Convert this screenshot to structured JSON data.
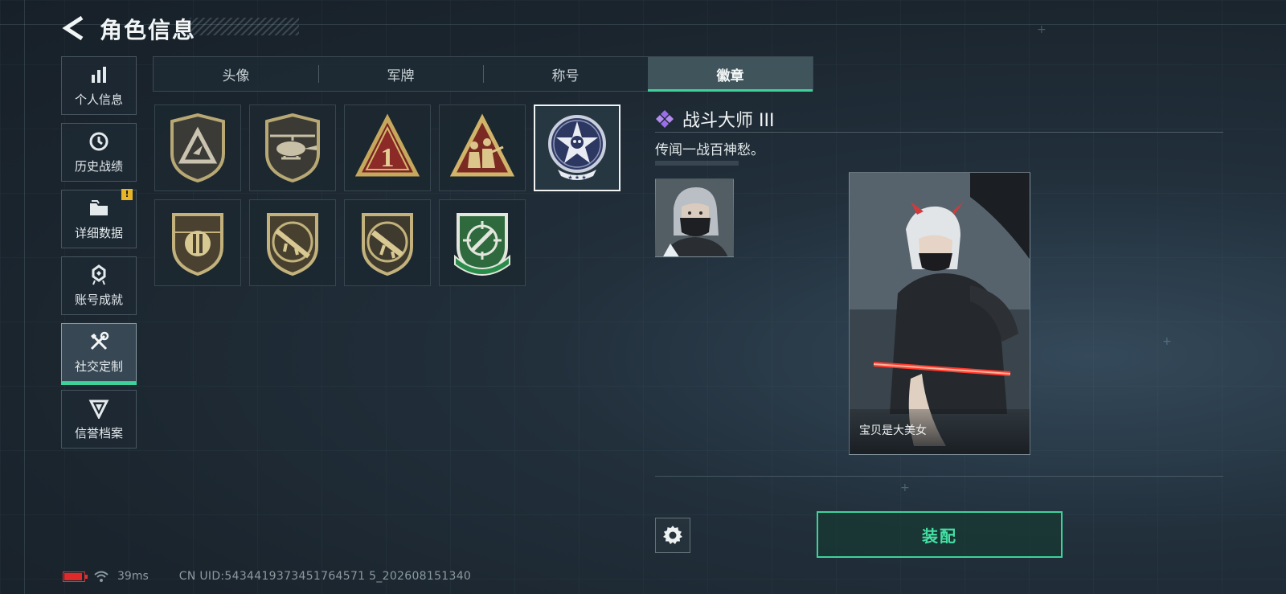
{
  "header": {
    "title": "角色信息"
  },
  "sidebar": {
    "items": [
      {
        "label": "个人信息",
        "icon": "bar-chart-icon"
      },
      {
        "label": "历史战绩",
        "icon": "clock-icon"
      },
      {
        "label": "详细数据",
        "icon": "folder-icon",
        "alert": "!"
      },
      {
        "label": "账号成就",
        "icon": "medal-icon"
      },
      {
        "label": "社交定制",
        "icon": "tools-icon",
        "active": true
      },
      {
        "label": "信誉档案",
        "icon": "shield-rank-icon"
      }
    ]
  },
  "tabs": [
    {
      "label": "头像"
    },
    {
      "label": "军牌"
    },
    {
      "label": "称号"
    },
    {
      "label": "徽章",
      "active": true
    }
  ],
  "badges": [
    {
      "icon": "triangle-shield-badge-icon"
    },
    {
      "icon": "helicopter-badge-icon"
    },
    {
      "icon": "number-one-badge-icon"
    },
    {
      "icon": "soldiers-badge-icon"
    },
    {
      "icon": "star-skull-badge-icon",
      "selected": true
    },
    {
      "icon": "bullet-shield-badge-icon"
    },
    {
      "icon": "rifle-badge-icon"
    },
    {
      "icon": "smg-badge-icon"
    },
    {
      "icon": "green-crosshair-badge-icon"
    }
  ],
  "detail": {
    "title": "战斗大师 III",
    "description": "传闻一战百神愁。",
    "card_caption": "宝贝是大美女",
    "equip_label": "装配"
  },
  "status": {
    "ping": "39ms",
    "uid": "CN UID:5434419373451764571 5_202608151340"
  },
  "colors": {
    "accent_green": "#3ed29a",
    "alert_yellow": "#e8b528",
    "battery_red": "#e02a2a",
    "gem_purple": "#9b6ee8"
  }
}
